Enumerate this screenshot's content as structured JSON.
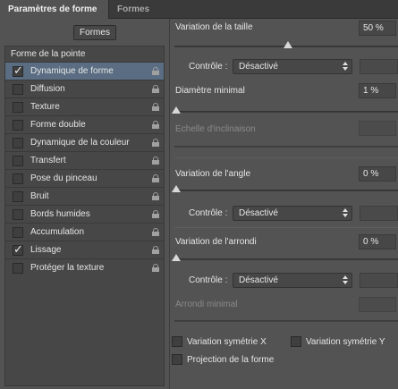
{
  "tabs": {
    "active": "Paramètres de forme",
    "inactive": "Formes"
  },
  "formes_button": "Formes",
  "list": {
    "heading": "Forme de la pointe",
    "items": [
      {
        "label": "Dynamique de forme",
        "checked": true,
        "selected": true
      },
      {
        "label": "Diffusion",
        "checked": false
      },
      {
        "label": "Texture",
        "checked": false
      },
      {
        "label": "Forme double",
        "checked": false
      },
      {
        "label": "Dynamique de la couleur",
        "checked": false
      },
      {
        "label": "Transfert",
        "checked": false
      },
      {
        "label": "Pose du pinceau",
        "checked": false
      },
      {
        "label": "Bruit",
        "checked": false
      },
      {
        "label": "Bords humides",
        "checked": false
      },
      {
        "label": "Accumulation",
        "checked": false
      },
      {
        "label": "Lissage",
        "checked": true
      },
      {
        "label": "Protéger la texture",
        "checked": false
      }
    ]
  },
  "settings": {
    "variation_taille": {
      "label": "Variation de la taille",
      "value": "50 %",
      "level": 0.5
    },
    "controle_1": {
      "label": "Contrôle :",
      "value": "Désactivé"
    },
    "diametre_minimal": {
      "label": "Diamètre minimal",
      "value": "1 %",
      "level": 0.01
    },
    "echelle_inclinaison": {
      "label": "Echelle d'inclinaison"
    },
    "variation_angle": {
      "label": "Variation de l'angle",
      "value": "0 %",
      "level": 0
    },
    "controle_2": {
      "label": "Contrôle :",
      "value": "Désactivé"
    },
    "variation_arrondi": {
      "label": "Variation de l'arrondi",
      "value": "0 %",
      "level": 0
    },
    "controle_3": {
      "label": "Contrôle :",
      "value": "Désactivé"
    },
    "arrondi_minimal": {
      "label": "Arrondi minimal"
    }
  },
  "bottom_checkboxes": {
    "symetrie_x": "Variation symétrie X",
    "symetrie_y": "Variation symétrie Y",
    "projection": "Projection de la forme"
  },
  "icons": {
    "lock": "lock-icon",
    "check": "checkmark-icon",
    "stepper": "up-down-arrows-icon"
  }
}
